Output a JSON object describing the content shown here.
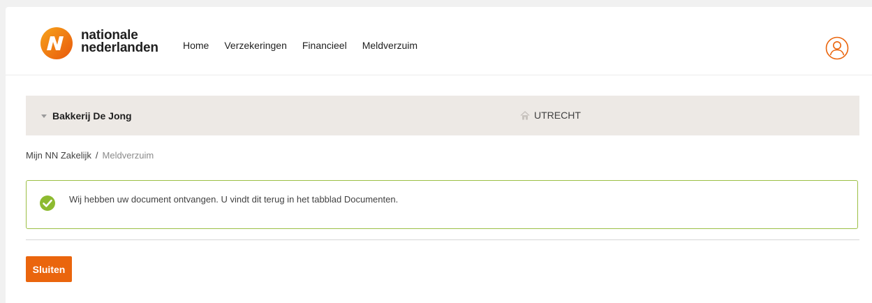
{
  "brand": {
    "line1": "nationale",
    "line2": "nederlanden",
    "logo_icon": "nn-logo-icon",
    "color": "#ea650d"
  },
  "nav": {
    "items": [
      {
        "label": "Home"
      },
      {
        "label": "Verzekeringen"
      },
      {
        "label": "Financieel"
      },
      {
        "label": "Meldverzuim"
      }
    ]
  },
  "header": {
    "user_icon": "user-icon"
  },
  "company_bar": {
    "company_name": "Bakkerij De Jong",
    "location": "UTRECHT",
    "location_icon": "home-icon",
    "background": "#ede9e5"
  },
  "breadcrumb": {
    "root": "Mijn NN Zakelijk",
    "separator": "/",
    "current": "Meldverzuim"
  },
  "alert": {
    "message": "Wij hebben uw document ontvangen. U vindt dit terug in het tabblad Documenten.",
    "icon": "check-circle-icon",
    "border_color": "#9cbf45"
  },
  "actions": {
    "close_label": "Sluiten",
    "button_color": "#ea650d"
  }
}
